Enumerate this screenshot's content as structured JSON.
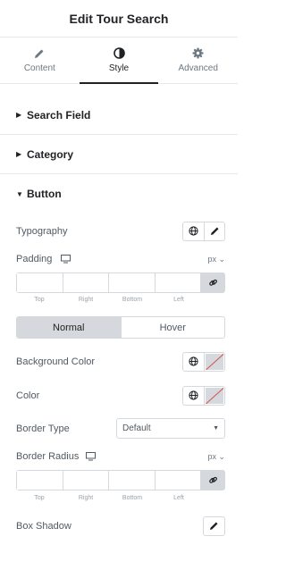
{
  "header": {
    "title": "Edit Tour Search"
  },
  "tabs": [
    {
      "label": "Content",
      "icon": "pencil-icon",
      "active": false
    },
    {
      "label": "Style",
      "icon": "contrast-icon",
      "active": true
    },
    {
      "label": "Advanced",
      "icon": "gear-icon",
      "active": false
    }
  ],
  "sections": [
    {
      "label": "Search Field",
      "open": false
    },
    {
      "label": "Category",
      "open": false
    },
    {
      "label": "Button",
      "open": true
    }
  ],
  "controls": {
    "typography": {
      "label": "Typography"
    },
    "padding": {
      "label": "Padding",
      "unit": "px",
      "dims": [
        "Top",
        "Right",
        "Bottom",
        "Left"
      ]
    },
    "state_toggle": {
      "normal": "Normal",
      "hover": "Hover",
      "active": "Normal"
    },
    "background_color": {
      "label": "Background Color"
    },
    "color": {
      "label": "Color"
    },
    "border_type": {
      "label": "Border Type",
      "value": "Default"
    },
    "border_radius": {
      "label": "Border Radius",
      "unit": "px",
      "dims": [
        "Top",
        "Right",
        "Bottom",
        "Left"
      ]
    },
    "box_shadow": {
      "label": "Box Shadow"
    }
  }
}
